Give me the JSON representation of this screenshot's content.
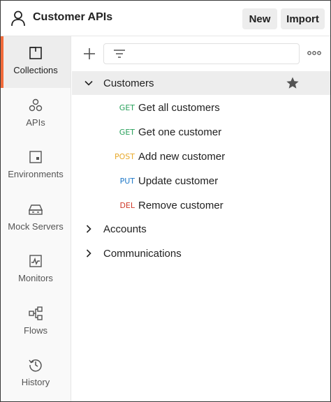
{
  "header": {
    "title": "Customer APIs",
    "new_label": "New",
    "import_label": "Import"
  },
  "sidebar": {
    "items": [
      {
        "label": "Collections",
        "icon": "collections-icon",
        "active": true
      },
      {
        "label": "APIs",
        "icon": "apis-icon",
        "active": false
      },
      {
        "label": "Environments",
        "icon": "environments-icon",
        "active": false
      },
      {
        "label": "Mock Servers",
        "icon": "mock-servers-icon",
        "active": false
      },
      {
        "label": "Monitors",
        "icon": "monitors-icon",
        "active": false
      },
      {
        "label": "Flows",
        "icon": "flows-icon",
        "active": false
      },
      {
        "label": "History",
        "icon": "history-icon",
        "active": false
      }
    ],
    "accent_color": "#f26b3a"
  },
  "tree": {
    "folders": [
      {
        "label": "Customers",
        "expanded": true,
        "starred": true,
        "requests": [
          {
            "method": "GET",
            "label": "Get all customers"
          },
          {
            "method": "GET",
            "label": "Get one customer"
          },
          {
            "method": "POST",
            "label": "Add new customer"
          },
          {
            "method": "PUT",
            "label": "Update customer"
          },
          {
            "method": "DEL",
            "label": "Remove customer"
          }
        ]
      },
      {
        "label": "Accounts",
        "expanded": false,
        "requests": []
      },
      {
        "label": "Communications",
        "expanded": false,
        "requests": []
      }
    ]
  },
  "method_colors": {
    "GET": "#27a05a",
    "POST": "#e8a92b",
    "PUT": "#1f78c8",
    "DEL": "#cf3a2a"
  }
}
